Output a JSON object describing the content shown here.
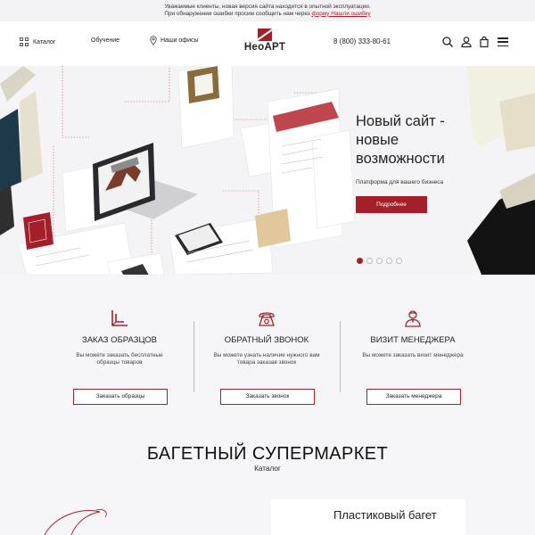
{
  "notice": {
    "line1": "Уважаемые клиенты, новая версия сайта находится в опытной эксплуатации.",
    "line2_prefix": "При обнаружении ошибки просим сообщить нам через ",
    "line2_link": "форму Нашли ошибку"
  },
  "header": {
    "catalog_label": "Каталог",
    "learning_label": "Обучение",
    "offices_label": "Наши офисы",
    "logo_text": "НеоАРТ",
    "phone": "8 (800) 333-80-61"
  },
  "hero": {
    "title": "Новый сайт - новые возможности",
    "subtitle": "Платформа для вашего бизнеса",
    "button_label": "Подробнее",
    "slides_count": 5,
    "active_slide": 1
  },
  "services": [
    {
      "title": "ЗАКАЗ ОБРАЗЦОВ",
      "desc": "Вы можете заказать бесплатные образцы товаров",
      "button": "Заказать образцы",
      "icon": "ruler-corner-icon"
    },
    {
      "title": "ОБРАТНЫЙ ЗВОНОК",
      "desc": "Вы можете узнать наличие нужного вам товара заказав звонок",
      "button": "Заказать звонок",
      "icon": "phone-icon"
    },
    {
      "title": "ВИЗИТ МЕНЕДЖЕРА",
      "desc": "Вы можете заказать визит менеджера",
      "button": "Заказать менеджера",
      "icon": "manager-icon"
    }
  ],
  "catalog": {
    "title": "БАГЕТНЫЙ СУПЕРМАРКЕТ",
    "subtitle": "Каталог",
    "card_plastic": "Пластиковый багет"
  },
  "colors": {
    "accent": "#a31f2a",
    "background": "#f6f6f8",
    "text": "#222222"
  }
}
